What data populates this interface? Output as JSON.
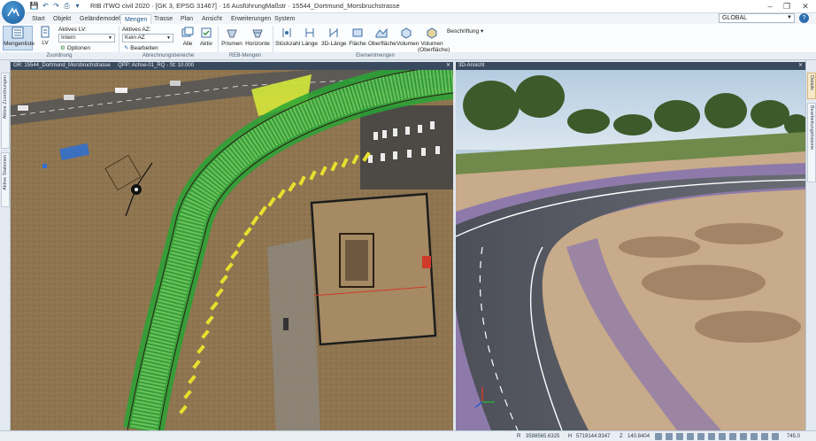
{
  "titlebar": {
    "title": "RIB iTWO civil 2020 · [GK 3, EPSG 31467] · 16 AusführungMaßstr · 15544_Dortmund_Morsbruchstrasse",
    "quick_access": [
      "save-icon",
      "undo-icon",
      "redo-icon",
      "print-icon",
      "dropdown-icon"
    ],
    "window_controls": [
      "–",
      "❐",
      "✕"
    ]
  },
  "menu": {
    "tabs": [
      "Start",
      "Objekt",
      "Geländemodell",
      "Mengen",
      "Trasse",
      "Plan",
      "Ansicht",
      "Erweiterungen",
      "System"
    ],
    "active": "Mengen",
    "global_select": "GLOBAL",
    "help": "?"
  },
  "ribbon": {
    "mengenliste": "Mengenliste",
    "lv": "LV",
    "aktives_lv_label": "Aktives LV:",
    "aktives_lv_value": "Intern",
    "optionen": "Optionen",
    "aktives_az_label": "Aktives AZ:",
    "aktives_az_value": "Kein AZ",
    "bearbeiten": "Bearbeiten",
    "alle": "Alle",
    "aktiv": "Aktiv",
    "buttons": [
      "Prismen",
      "Horizonte",
      "Stückzahl",
      "Länge",
      "3D-Länge",
      "Fläche",
      "Oberfläche",
      "Volumen",
      "Volumen (Oberfläche)"
    ],
    "beschriftung": "Beschriftung",
    "groups": [
      "Zuordnung",
      "Abrechnungsbereiche",
      "REB-Mengen",
      "Elementmengen"
    ]
  },
  "left_tabs": [
    "Aktive Zuordnungen",
    "Aktive Stationen"
  ],
  "right_tabs": [
    "Details",
    "Bearbeitungshistorie"
  ],
  "viewports": {
    "plan": {
      "title": "GR: 15544_Dortmund_Morsbruchstrasse",
      "subtitle": "QPP: Achse-01_RQ - St: 10.000"
    },
    "view3d": {
      "title": "3D-Ansicht"
    }
  },
  "status": {
    "r_label": "R",
    "r": "3598565.6325",
    "h_label": "H",
    "h": "5719144.9347",
    "z_label": "Z",
    "z": "140.8404",
    "scale": "745.0"
  },
  "colors": {
    "accent": "#1a5a9a",
    "active_tab": "#1a4f86",
    "road_marking": "#e9df2e",
    "survey_green": "#2fbf3a",
    "pointcloud_blue": "#4a3fd0"
  }
}
